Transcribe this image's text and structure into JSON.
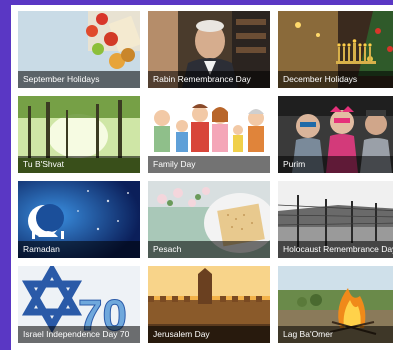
{
  "tiles": [
    {
      "label": "September Holidays"
    },
    {
      "label": "Rabin Remembrance Day"
    },
    {
      "label": "December Holidays"
    },
    {
      "label": "Tu B'Shvat"
    },
    {
      "label": "Family Day"
    },
    {
      "label": "Purim"
    },
    {
      "label": "Ramadan"
    },
    {
      "label": "Pesach"
    },
    {
      "label": "Holocaust Remembrance Day"
    },
    {
      "label": "Israel Independence Day 70"
    },
    {
      "label": "Jerusalem Day"
    },
    {
      "label": "Lag Ba'Omer"
    }
  ],
  "colors": {
    "background": "#5a37c4",
    "panel": "#ffffff",
    "caption_overlay": "rgba(0,0,0,0.55)"
  }
}
